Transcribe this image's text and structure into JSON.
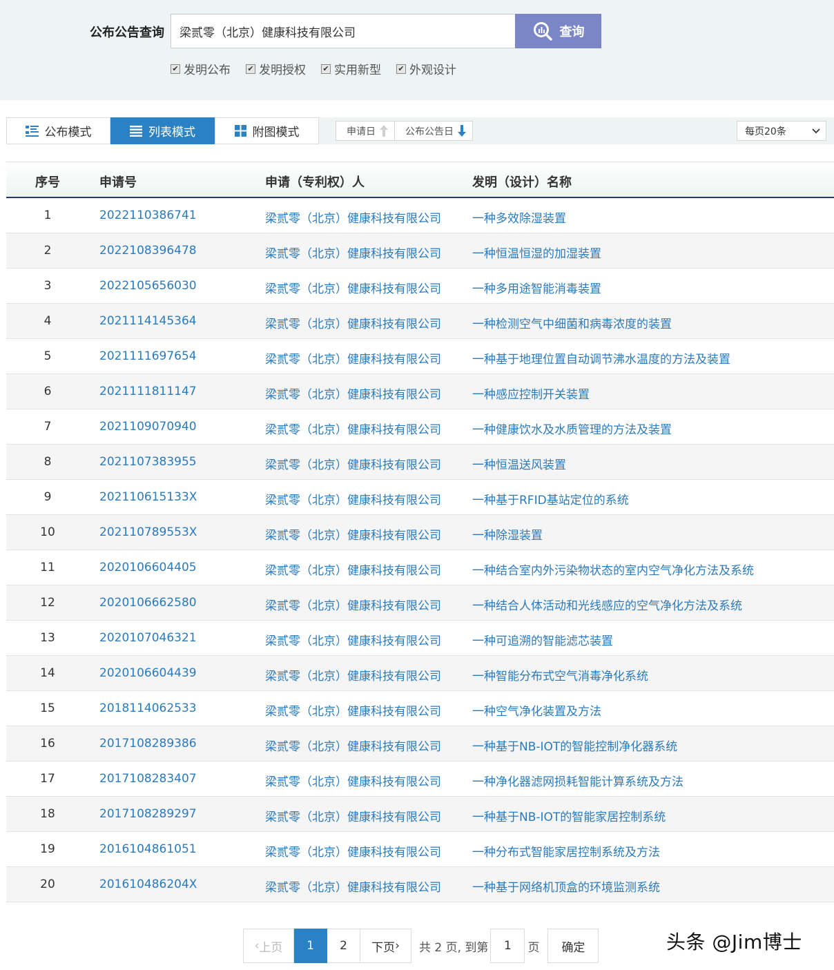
{
  "search": {
    "label": "公布公告查询",
    "value": "梁贰零（北京）健康科技有限公司",
    "button_label": "查询",
    "checkboxes": [
      {
        "label": "发明公布",
        "checked": true
      },
      {
        "label": "发明授权",
        "checked": true
      },
      {
        "label": "实用新型",
        "checked": true
      },
      {
        "label": "外观设计",
        "checked": true
      }
    ]
  },
  "toolbar": {
    "modes": [
      {
        "label": "公布模式",
        "icon": "list-detail-icon",
        "active": false
      },
      {
        "label": "列表模式",
        "icon": "list-icon",
        "active": true
      },
      {
        "label": "附图模式",
        "icon": "grid-icon",
        "active": false
      }
    ],
    "sort": [
      {
        "label": "申请日",
        "direction": "up",
        "active": false
      },
      {
        "label": "公布公告日",
        "direction": "down",
        "active": true
      }
    ],
    "per_page": "每页20条"
  },
  "table": {
    "headers": [
      "序号",
      "申请号",
      "申请（专利权）人",
      "发明（设计）名称"
    ],
    "rows": [
      [
        "1",
        "2022110386741",
        "梁贰零（北京）健康科技有限公司",
        "一种多效除湿装置"
      ],
      [
        "2",
        "2022108396478",
        "梁贰零（北京）健康科技有限公司",
        "一种恒温恒湿的加湿装置"
      ],
      [
        "3",
        "2022105656030",
        "梁贰零（北京）健康科技有限公司",
        "一种多用途智能消毒装置"
      ],
      [
        "4",
        "2021114145364",
        "梁贰零（北京）健康科技有限公司",
        "一种检测空气中细菌和病毒浓度的装置"
      ],
      [
        "5",
        "2021111697654",
        "梁贰零（北京）健康科技有限公司",
        "一种基于地理位置自动调节沸水温度的方法及装置"
      ],
      [
        "6",
        "2021111811147",
        "梁贰零（北京）健康科技有限公司",
        "一种感应控制开关装置"
      ],
      [
        "7",
        "2021109070940",
        "梁贰零（北京）健康科技有限公司",
        "一种健康饮水及水质管理的方法及装置"
      ],
      [
        "8",
        "2021107383955",
        "梁贰零（北京）健康科技有限公司",
        "一种恒温送风装置"
      ],
      [
        "9",
        "202110615133X",
        "梁贰零（北京）健康科技有限公司",
        "一种基于RFID基站定位的系统"
      ],
      [
        "10",
        "202110789553X",
        "梁贰零（北京）健康科技有限公司",
        "一种除湿装置"
      ],
      [
        "11",
        "2020106604405",
        "梁贰零（北京）健康科技有限公司",
        "一种结合室内外污染物状态的室内空气净化方法及系统"
      ],
      [
        "12",
        "2020106662580",
        "梁贰零（北京）健康科技有限公司",
        "一种结合人体活动和光线感应的空气净化方法及系统"
      ],
      [
        "13",
        "2020107046321",
        "梁贰零（北京）健康科技有限公司",
        "一种可追溯的智能滤芯装置"
      ],
      [
        "14",
        "2020106604439",
        "梁贰零（北京）健康科技有限公司",
        "一种智能分布式空气消毒净化系统"
      ],
      [
        "15",
        "2018114062533",
        "梁贰零（北京）健康科技有限公司",
        "一种空气净化装置及方法"
      ],
      [
        "16",
        "2017108289386",
        "梁贰零（北京）健康科技有限公司",
        "一种基于NB-IOT的智能控制净化器系统"
      ],
      [
        "17",
        "2017108283407",
        "梁贰零（北京）健康科技有限公司",
        "一种净化器滤网损耗智能计算系统及方法"
      ],
      [
        "18",
        "2017108289297",
        "梁贰零（北京）健康科技有限公司",
        "一种基于NB-IOT的智能家居控制系统"
      ],
      [
        "19",
        "2016104861051",
        "梁贰零（北京）健康科技有限公司",
        "一种分布式智能家居控制系统及方法"
      ],
      [
        "20",
        "201610486204X",
        "梁贰零（北京）健康科技有限公司",
        "一种基于网络机顶盒的环境监测系统"
      ]
    ]
  },
  "pagination": {
    "prev_label": "上页",
    "next_label": "下页",
    "pages": [
      "1",
      "2"
    ],
    "current_page": "1",
    "total_text": "共 2 页, 到第",
    "goto_value": "1",
    "page_suffix": "页",
    "confirm_label": "确定"
  },
  "watermark": "头条 @Jim博士",
  "colors": {
    "accent": "#2a82c4",
    "search_button": "#7b86c6",
    "link": "#2b7abd",
    "header_rule": "#25386a",
    "panel_bg": "#eef3f4"
  }
}
